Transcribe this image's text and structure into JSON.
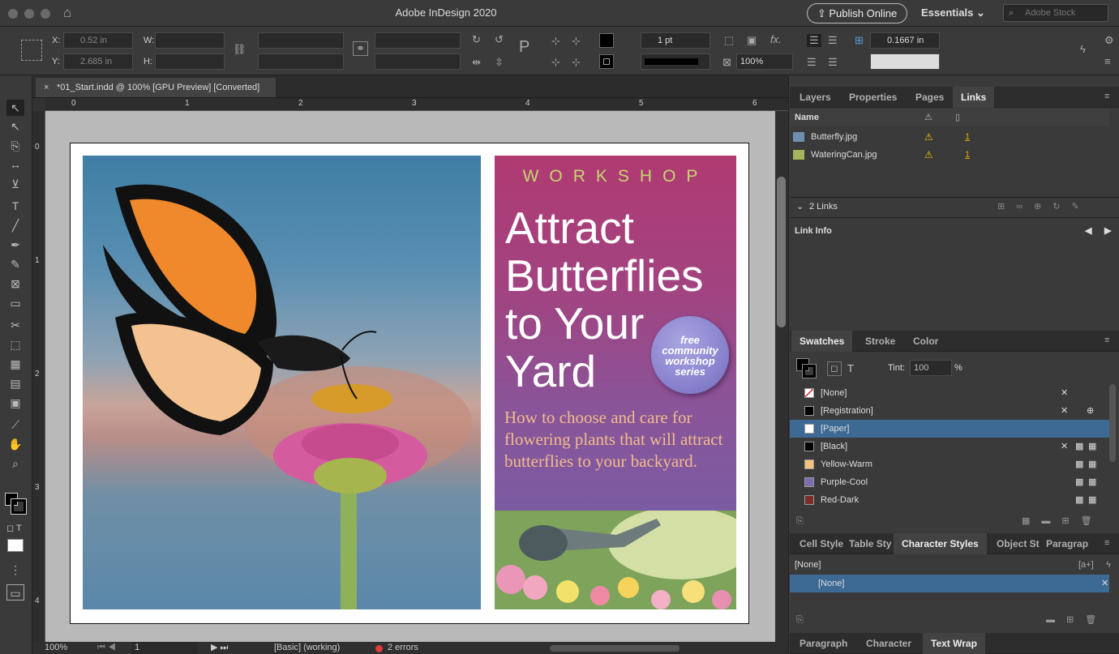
{
  "window": {
    "title": "Adobe InDesign 2020",
    "publish_label": "Publish Online",
    "workspace": "Essentials",
    "stock_placeholder": "Adobe Stock"
  },
  "control": {
    "x_label": "X:",
    "x_value": "0.52 in",
    "y_label": "Y:",
    "y_value": "2.685 in",
    "w_label": "W:",
    "h_label": "H:",
    "stroke_weight": "1 pt",
    "scale": "100%",
    "spacing": "0.1667 in"
  },
  "doc_tab": {
    "close": "×",
    "title": "*01_Start.indd @ 100% [GPU Preview] [Converted]"
  },
  "ruler": {
    "h": [
      "0",
      "1",
      "2",
      "3",
      "4",
      "5",
      "6"
    ],
    "v": [
      "0",
      "1",
      "2",
      "3",
      "4"
    ]
  },
  "poster": {
    "label": "WORKSHOP",
    "title_lines": [
      "Attract",
      "Butterflies",
      "to Your",
      "Yard"
    ],
    "subtitle": "How to choose and care for flowering plants that will attract butterflies to your backyard.",
    "badge_lines": [
      "free",
      "community",
      "workshop",
      "series"
    ]
  },
  "status": {
    "zoom": "100%",
    "page": "1",
    "style": "[Basic] (working)",
    "errors": "2 errors"
  },
  "links_panel": {
    "tabs": [
      "Layers",
      "Properties",
      "Pages",
      "Links"
    ],
    "active": "Links",
    "col_name": "Name",
    "rows": [
      {
        "name": "Butterfly.jpg",
        "page": "1"
      },
      {
        "name": "WateringCan.jpg",
        "page": "1"
      }
    ],
    "count": "2 Links",
    "info": "Link Info"
  },
  "swatches_panel": {
    "tabs": [
      "Swatches",
      "Stroke",
      "Color"
    ],
    "tint_label": "Tint:",
    "tint": "100",
    "tint_unit": "%",
    "t_label": "T",
    "rows": [
      {
        "name": "[None]",
        "color": "#ffffff"
      },
      {
        "name": "[Registration]",
        "color": "#000000"
      },
      {
        "name": "[Paper]",
        "color": "#ffffff"
      },
      {
        "name": "[Black]",
        "color": "#000000"
      },
      {
        "name": "Yellow-Warm",
        "color": "#f6c07f"
      },
      {
        "name": "Purple-Cool",
        "color": "#7d6cae"
      },
      {
        "name": "Red-Dark",
        "color": "#7a2e2a"
      }
    ],
    "selected": "[Paper]"
  },
  "char_styles_panel": {
    "tabs": [
      "Cell Style",
      "Table Sty",
      "Character Styles",
      "Object St",
      "Paragrap"
    ],
    "active": "Character Styles",
    "current": "[None]",
    "row": "[None]"
  },
  "bottom_tabs": [
    "Paragraph",
    "Character",
    "Text Wrap"
  ]
}
